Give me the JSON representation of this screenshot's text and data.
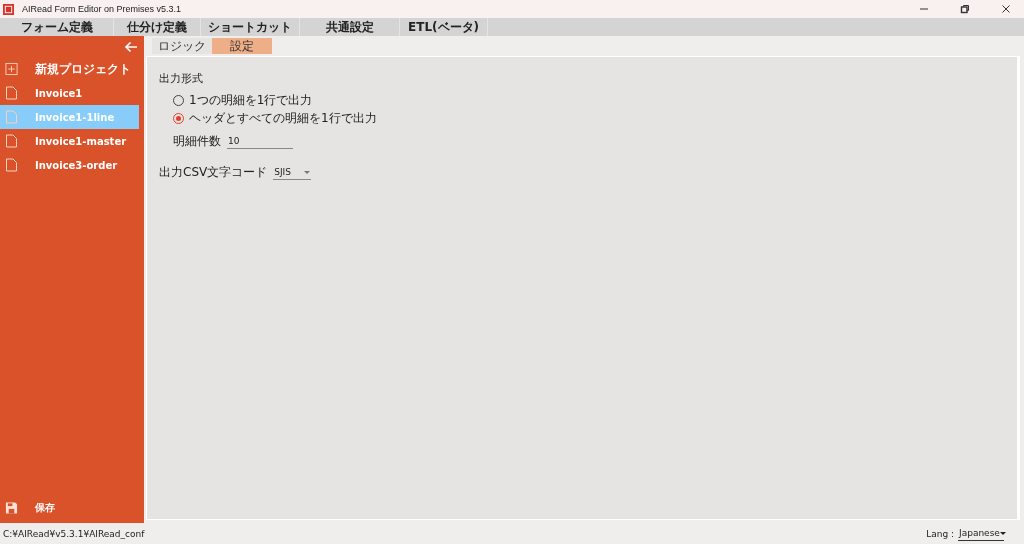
{
  "window": {
    "title": "AIRead Form Editor on Premises v5.3.1"
  },
  "tabs": [
    {
      "label": "フォーム定義",
      "selected": false
    },
    {
      "label": "仕分け定義",
      "selected": false
    },
    {
      "label": "ショートカット",
      "selected": false
    },
    {
      "label": "共通設定",
      "selected": false
    },
    {
      "label": "ETL(ベータ)",
      "selected": false
    }
  ],
  "sidebar": {
    "new_project": "新規プロジェクト",
    "items": [
      {
        "label": "Invoice1",
        "selected": false
      },
      {
        "label": "Invoice1-1line",
        "selected": true
      },
      {
        "label": "Invoice1-master",
        "selected": false
      },
      {
        "label": "Invoice3-order",
        "selected": false
      }
    ],
    "save": "保存"
  },
  "subtabs": [
    {
      "label": "ロジック",
      "selected": false
    },
    {
      "label": "設定",
      "selected": true
    }
  ],
  "settings": {
    "output_format_label": "出力形式",
    "options": [
      {
        "label": "1つの明細を1行で出力",
        "selected": false
      },
      {
        "label": "ヘッダとすべての明細を1行で出力",
        "selected": true
      }
    ],
    "detail_count_label": "明細件数",
    "detail_count": "10",
    "encoding_label": "出力CSV文字コード",
    "encoding": "SJIS"
  },
  "status_bar": {
    "path": "C:¥AIRead¥v5.3.1¥AIRead_conf",
    "lang_label": "Lang :",
    "lang": "Japanese"
  }
}
